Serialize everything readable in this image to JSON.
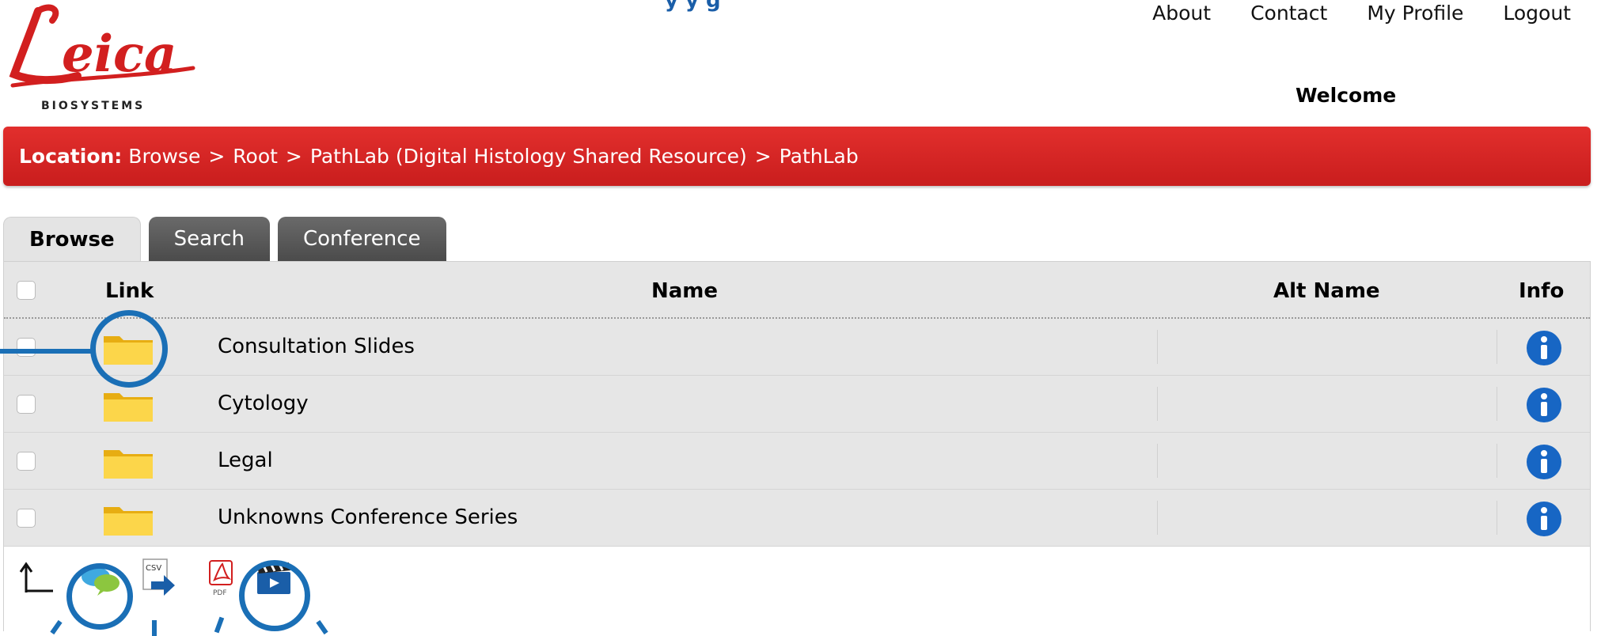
{
  "page": {
    "cut_title": "y    y g"
  },
  "logo": {
    "brand": "Leica",
    "sub": "BIOSYSTEMS"
  },
  "nav": {
    "about": "About",
    "contact": "Contact",
    "profile": "My Profile",
    "logout": "Logout"
  },
  "welcome": "Welcome",
  "location": {
    "label": "Location:",
    "crumbs": [
      "Browse",
      "Root",
      "PathLab (Digital Histology Shared Resource)",
      "PathLab"
    ],
    "separator": ">"
  },
  "tabs": [
    {
      "label": "Browse",
      "active": true
    },
    {
      "label": "Search",
      "active": false
    },
    {
      "label": "Conference",
      "active": false
    }
  ],
  "table": {
    "headers": {
      "link": "Link",
      "name": "Name",
      "alt_name": "Alt Name",
      "info": "Info"
    },
    "rows": [
      {
        "name": "Consultation Slides",
        "alt_name": "",
        "icon": "folder-icon"
      },
      {
        "name": "Cytology",
        "alt_name": "",
        "icon": "folder-icon"
      },
      {
        "name": "Legal",
        "alt_name": "",
        "icon": "folder-icon"
      },
      {
        "name": "Unknowns Conference Series",
        "alt_name": "",
        "icon": "folder-icon"
      }
    ]
  },
  "footer_icons": {
    "up": "up-arrow-icon",
    "chat": "chat-icon",
    "csv": "CSV",
    "pdf": "PDF",
    "video": "video-clapper-icon"
  },
  "colors": {
    "location_bar": "#d92626",
    "callout": "#1a6fb6",
    "info_blue": "#1766c4",
    "folder": "#f4c430"
  }
}
